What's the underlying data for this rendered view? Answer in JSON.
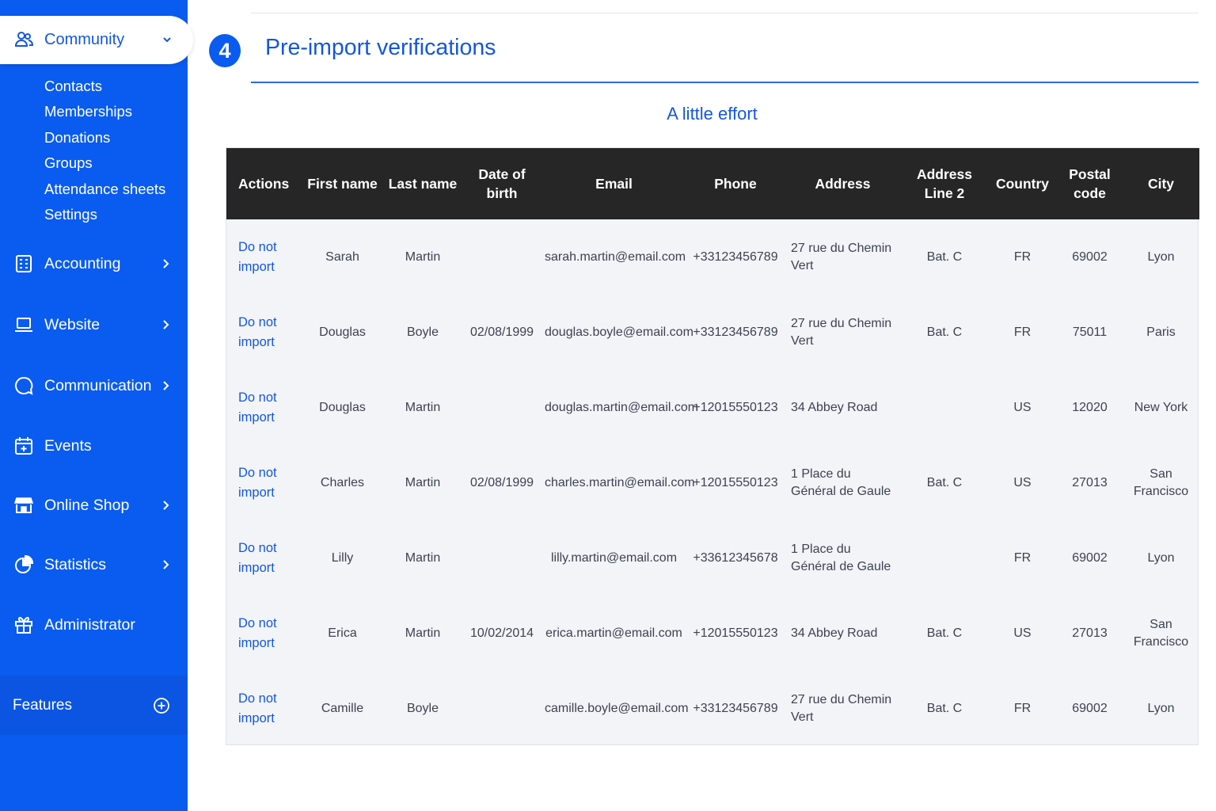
{
  "sidebar": {
    "community": {
      "label": "Community",
      "items": [
        "Contacts",
        "Memberships",
        "Donations",
        "Groups",
        "Attendance sheets",
        "Settings"
      ]
    },
    "nav": [
      {
        "label": "Accounting",
        "icon": "building-icon",
        "chevron": true
      },
      {
        "label": "Website",
        "icon": "laptop-icon",
        "chevron": true
      },
      {
        "label": "Communication",
        "icon": "chat-bubble-icon",
        "chevron": true
      },
      {
        "label": "Events",
        "icon": "calendar-plus-icon",
        "chevron": false
      },
      {
        "label": "Online Shop",
        "icon": "shop-icon",
        "chevron": true
      },
      {
        "label": "Statistics",
        "icon": "pie-chart-icon",
        "chevron": true
      },
      {
        "label": "Administrator",
        "icon": "gift-icon",
        "chevron": false
      }
    ],
    "features_label": "Features",
    "colors": {
      "background": "#0a5cf0",
      "features_background": "#0b55e2",
      "accent": "#1456e0"
    }
  },
  "main": {
    "step_number": "4",
    "title": "Pre-import verifications",
    "subtitle": "A little effort",
    "table": {
      "headers": [
        "Actions",
        "First name",
        "Last name",
        "Date of birth",
        "Email",
        "Phone",
        "Address",
        "Address Line 2",
        "Country",
        "Postal code",
        "City"
      ],
      "rows": [
        {
          "action": "Do not import",
          "first_name": "Sarah",
          "last_name": "Martin",
          "dob": "",
          "email": "sarah.martin@email.com",
          "phone": "+33123456789",
          "address": "27 rue du Chemin Vert",
          "address2": "Bat. C",
          "country": "FR",
          "postal": "69002",
          "city": "Lyon"
        },
        {
          "action": "Do not import",
          "first_name": "Douglas",
          "last_name": "Boyle",
          "dob": "02/08/1999",
          "email": "douglas.boyle@email.com",
          "phone": "+33123456789",
          "address": "27 rue du Chemin Vert",
          "address2": "Bat. C",
          "country": "FR",
          "postal": "75011",
          "city": "Paris"
        },
        {
          "action": "Do not import",
          "first_name": "Douglas",
          "last_name": "Martin",
          "dob": "",
          "email": "douglas.martin@email.com",
          "phone": "+12015550123",
          "address": "34 Abbey Road",
          "address2": "",
          "country": "US",
          "postal": "12020",
          "city": "New York"
        },
        {
          "action": "Do not import",
          "first_name": "Charles",
          "last_name": "Martin",
          "dob": "02/08/1999",
          "email": "charles.martin@email.com",
          "phone": "+12015550123",
          "address": "1 Place du Général de Gaule",
          "address2": "Bat. C",
          "country": "US",
          "postal": "27013",
          "city": "San Francisco"
        },
        {
          "action": "Do not import",
          "first_name": "Lilly",
          "last_name": "Martin",
          "dob": "",
          "email": "lilly.martin@email.com",
          "phone": "+33612345678",
          "address": "1 Place du Général de Gaule",
          "address2": "",
          "country": "FR",
          "postal": "69002",
          "city": "Lyon"
        },
        {
          "action": "Do not import",
          "first_name": "Erica",
          "last_name": "Martin",
          "dob": "10/02/2014",
          "email": "erica.martin@email.com",
          "phone": "+12015550123",
          "address": "34 Abbey Road",
          "address2": "Bat. C",
          "country": "US",
          "postal": "27013",
          "city": "San Francisco"
        },
        {
          "action": "Do not import",
          "first_name": "Camille",
          "last_name": "Boyle",
          "dob": "",
          "email": "camille.boyle@email.com",
          "phone": "+33123456789",
          "address": "27 rue du Chemin Vert",
          "address2": "Bat. C",
          "country": "FR",
          "postal": "69002",
          "city": "Lyon"
        }
      ]
    }
  }
}
